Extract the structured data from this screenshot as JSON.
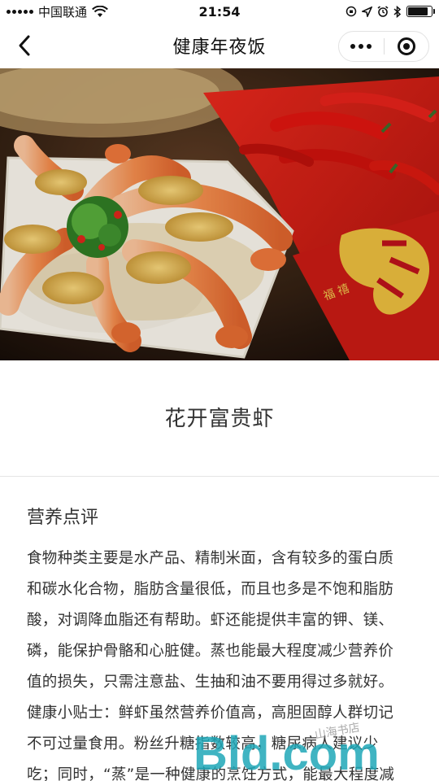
{
  "status_bar": {
    "carrier": "中国联通",
    "time": "21:54",
    "battery_level": 0.85,
    "icons": [
      "signal-icon",
      "wifi-icon",
      "screen-lock-icon",
      "location-icon",
      "alarm-icon",
      "bluetooth-icon",
      "battery-icon"
    ]
  },
  "nav": {
    "title": "健康年夜饭",
    "back_icon": "chevron-left-icon",
    "more_icon": "more-dots-icon",
    "close_icon": "mini-program-close-icon"
  },
  "hero": {
    "description_icon": "shrimp-dish-photo",
    "accent_colors": [
      "#d21f16",
      "#f0a060",
      "#e8c24a",
      "#2a1a10"
    ]
  },
  "dish": {
    "title": "花开富贵虾"
  },
  "section": {
    "title": "营养点评",
    "lines": [
      "食物种类主要是水产品、精制米面，含有较多的蛋白质",
      "和碳水化合物，脂肪含量很低，而且也多是不饱和脂肪",
      "酸，对调降血脂还有帮助。虾还能提供丰富的钾、镁、",
      "磷，能保护骨骼和心脏健。蒸也能最大程度减少营养价",
      "值的损失，只需注意盐、生抽和油不要用得过多就好。",
      "健康小贴士：鲜虾虽然营养价值高，高胆固醇人群切记",
      "不可过量食用。粉丝升糖指数较高，糖尿病人建议少",
      "吃；同时，“蒸”是一种健康的烹饪方式，能最大程度减"
    ]
  },
  "watermark": {
    "text": "Bld.com",
    "small_text": "山海书店"
  }
}
